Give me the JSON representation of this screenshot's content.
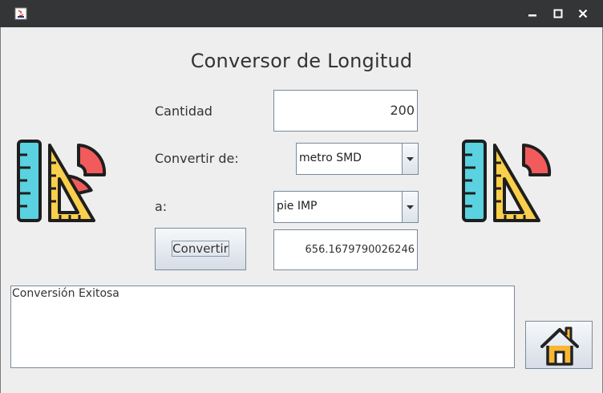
{
  "window": {
    "icons": {
      "app": "java-app-icon",
      "minimize": "minimize-icon",
      "maximize": "maximize-icon",
      "close": "close-icon"
    }
  },
  "main": {
    "title": "Conversor de Longitud",
    "cantidad_label": "Cantidad",
    "cantidad_value": "200",
    "convertir_de_label": "Convertir de:",
    "convertir_de_value": "metro SMD",
    "a_label": "a:",
    "a_value": "pie IMP",
    "convert_button": "Convertir",
    "result_value": "656.1679790026246",
    "message": "Conversión Exitosa"
  },
  "icons": {
    "logo": "ruler-triangle-protractor-icon",
    "home": "home-icon",
    "dropdown": "chevron-down-icon"
  },
  "colors": {
    "ruler": "#5ad2e0",
    "triangle": "#f9cf4b",
    "protractor": "#f25b5b",
    "home_fill": "#f7b733",
    "home_outline": "#222222"
  }
}
